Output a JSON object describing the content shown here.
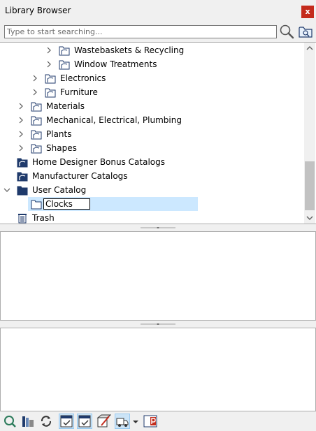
{
  "window": {
    "title": "Library Browser",
    "close_label": "x"
  },
  "search": {
    "placeholder": "Type to start searching..."
  },
  "tree": {
    "items": [
      {
        "label": "Wastebaskets & Recycling"
      },
      {
        "label": "Window Treatments"
      },
      {
        "label": "Electronics"
      },
      {
        "label": "Furniture"
      },
      {
        "label": "Materials"
      },
      {
        "label": "Mechanical, Electrical, Plumbing"
      },
      {
        "label": "Plants"
      },
      {
        "label": "Shapes"
      },
      {
        "label": "Home Designer Bonus Catalogs"
      },
      {
        "label": "Manufacturer Catalogs"
      },
      {
        "label": "User Catalog"
      },
      {
        "label": "Clocks"
      },
      {
        "label": "Trash"
      }
    ],
    "rename_value": "Clocks"
  },
  "colors": {
    "folder_dark": "#1f3a6b",
    "selection": "#cce8ff",
    "close": "#c42b1c"
  },
  "icons": {
    "toolbar": [
      "search-zoom-icon",
      "library-books-icon",
      "sync-icon",
      "add-to-plan-icon",
      "checklist-icon",
      "material-eyedropper-icon",
      "truck-icon",
      "dropdown-arrow-icon",
      "part-p-icon"
    ]
  }
}
